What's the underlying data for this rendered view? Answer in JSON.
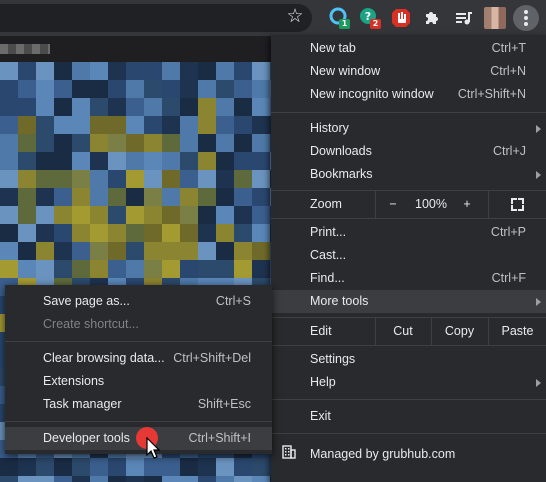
{
  "toolbar": {
    "extensions": [
      {
        "name": "ext-circle-icon",
        "badge": "1",
        "badge_color": "#1a9c5e"
      },
      {
        "name": "ext-help-icon",
        "badge": "2",
        "badge_color": "#d93025"
      },
      {
        "name": "ext-hand-stop-icon"
      },
      {
        "name": "puzzle-icon"
      },
      {
        "name": "media-control-icon"
      }
    ]
  },
  "menu": {
    "new_tab": {
      "label": "New tab",
      "shortcut": "Ctrl+T"
    },
    "new_window": {
      "label": "New window",
      "shortcut": "Ctrl+N"
    },
    "new_incognito": {
      "label": "New incognito window",
      "shortcut": "Ctrl+Shift+N"
    },
    "history": {
      "label": "History"
    },
    "downloads": {
      "label": "Downloads",
      "shortcut": "Ctrl+J"
    },
    "bookmarks": {
      "label": "Bookmarks"
    },
    "zoom": {
      "label": "Zoom",
      "minus": "−",
      "value": "100%",
      "plus": "+"
    },
    "print": {
      "label": "Print...",
      "shortcut": "Ctrl+P"
    },
    "cast": {
      "label": "Cast..."
    },
    "find": {
      "label": "Find...",
      "shortcut": "Ctrl+F"
    },
    "more_tools": {
      "label": "More tools"
    },
    "edit": {
      "label": "Edit",
      "cut": "Cut",
      "copy": "Copy",
      "paste": "Paste"
    },
    "settings": {
      "label": "Settings"
    },
    "help": {
      "label": "Help"
    },
    "exit": {
      "label": "Exit"
    },
    "managed": {
      "label": "Managed by grubhub.com"
    }
  },
  "submenu": {
    "save_page": {
      "label": "Save page as...",
      "shortcut": "Ctrl+S"
    },
    "create_shortcut": {
      "label": "Create shortcut..."
    },
    "clear_browsing": {
      "label": "Clear browsing data...",
      "shortcut": "Ctrl+Shift+Del"
    },
    "extensions": {
      "label": "Extensions"
    },
    "task_manager": {
      "label": "Task manager",
      "shortcut": "Shift+Esc"
    },
    "developer_tools": {
      "label": "Developer tools",
      "shortcut": "Ctrl+Shift+I"
    }
  },
  "colors": {
    "menu_bg": "#292a2d",
    "highlight": "#3c3d40",
    "click_indicator": "#e53935"
  }
}
